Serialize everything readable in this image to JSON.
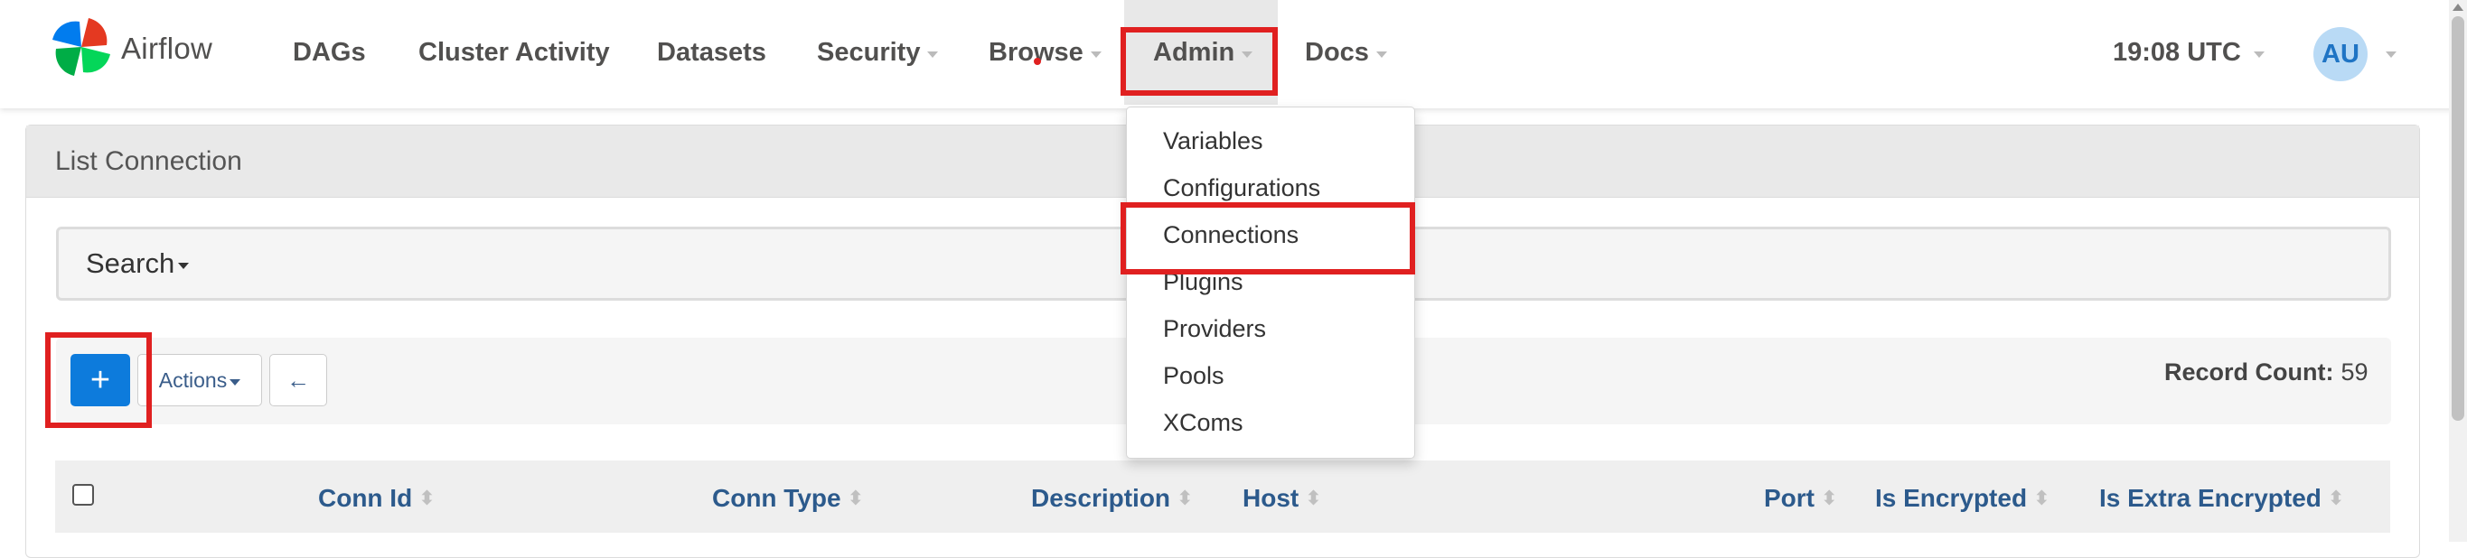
{
  "app": {
    "brand_name": "Airflow",
    "logo_colors": [
      "#017cee",
      "#00ad46",
      "#e43921",
      "#04d659"
    ]
  },
  "nav": {
    "dags": "DAGs",
    "cluster_activity": "Cluster Activity",
    "datasets": "Datasets",
    "security": "Security",
    "browse": "Browse",
    "admin": "Admin",
    "docs": "Docs",
    "time": "19:08 UTC",
    "user_initials": "AU"
  },
  "admin_menu": {
    "items": [
      "Variables",
      "Configurations",
      "Connections",
      "Plugins",
      "Providers",
      "Pools",
      "XComs"
    ]
  },
  "panel": {
    "title": "List Connection",
    "search_label": "Search",
    "add_label": "+",
    "actions_label": "Actions",
    "back_icon": "←",
    "record_count_label": "Record Count:",
    "record_count_value": "59"
  },
  "table": {
    "columns": [
      "Conn Id",
      "Conn Type",
      "Description",
      "Host",
      "Port",
      "Is Encrypted",
      "Is Extra Encrypted"
    ]
  },
  "colors": {
    "highlight": "#e02020",
    "primary_button": "#0d7bdc",
    "header_link": "#2c5a8c"
  }
}
